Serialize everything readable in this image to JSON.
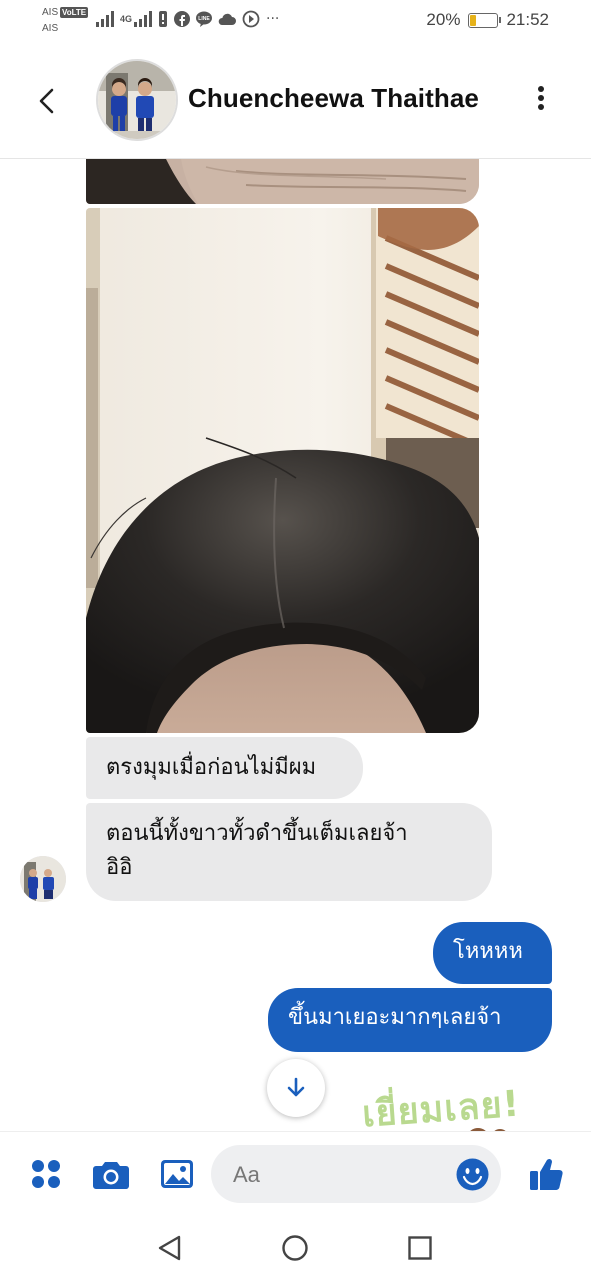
{
  "status_bar": {
    "carrier_1": "AIS",
    "carrier_2": "AIS",
    "volte": "VoLTE",
    "network": "4G",
    "battery_percent": "20%",
    "battery_level": 0.2,
    "time": "21:52",
    "overflow": "···"
  },
  "header": {
    "contact_name": "Chuencheewa Thaithae"
  },
  "messages": {
    "incoming_1": "ตรงมุมเมื่อก่อนไม่มีผม",
    "incoming_2_line1": "ตอนนี้ทั้งขาวทั้วดำขึ้นเต็มเลยจ้า",
    "incoming_2_line2": "อิอิ",
    "outgoing_1": "โหหหห",
    "outgoing_2": "ขึ้นมาเยอะมากๆเลยจ้า",
    "sticker_text": "เยี่ยมเลย!"
  },
  "composer": {
    "placeholder": "Aa"
  },
  "icons": {
    "back": "back-arrow-icon",
    "more": "more-vertical-icon",
    "apps": "apps-grid-icon",
    "camera": "camera-icon",
    "gallery": "gallery-icon",
    "emoji": "emoji-icon",
    "like": "thumbs-up-icon",
    "scroll_down": "arrow-down-icon"
  },
  "colors": {
    "accent": "#1a5fbd",
    "incoming_bubble": "#e9e9ea",
    "battery": "#e6b21a"
  }
}
